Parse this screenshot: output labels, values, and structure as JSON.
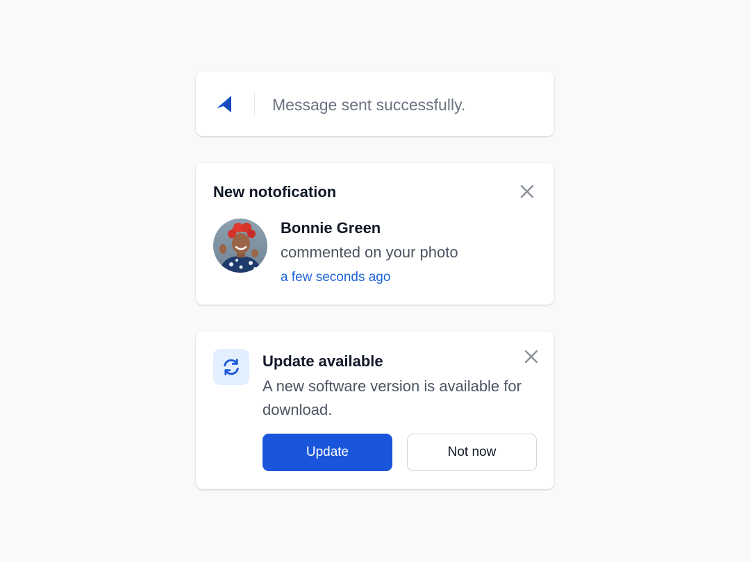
{
  "sent_toast": {
    "icon": "paper-plane-icon",
    "message": "Message sent successfully."
  },
  "notification_toast": {
    "title": "New notofication",
    "close_icon": "close-icon",
    "user_name": "Bonnie Green",
    "action": "commented on your photo",
    "time": "a few seconds ago"
  },
  "update_toast": {
    "icon": "refresh-icon",
    "title": "Update available",
    "description": "A new software version is available for download.",
    "close_icon": "close-icon",
    "primary_label": "Update",
    "secondary_label": "Not now"
  },
  "colors": {
    "background": "#f9f9f9",
    "accent": "#1a56db",
    "link": "#1d64d8",
    "icon_bg": "#e1effe",
    "muted": "#6b7280"
  }
}
